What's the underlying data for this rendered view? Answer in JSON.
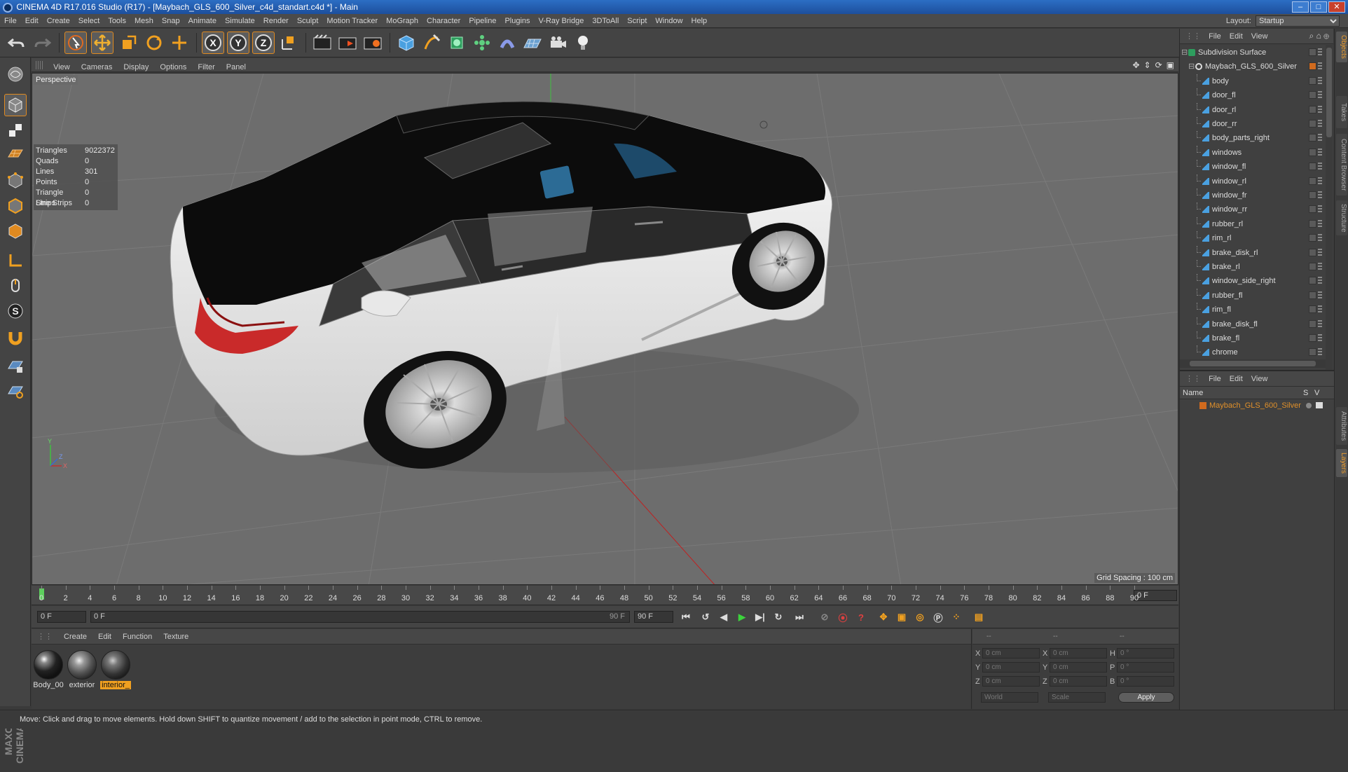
{
  "window": {
    "title": "CINEMA 4D R17.016 Studio (R17) - [Maybach_GLS_600_Silver_c4d_standart.c4d *] - Main"
  },
  "menubar": [
    "File",
    "Edit",
    "Create",
    "Select",
    "Tools",
    "Mesh",
    "Snap",
    "Animate",
    "Simulate",
    "Render",
    "Sculpt",
    "Motion Tracker",
    "MoGraph",
    "Character",
    "Pipeline",
    "Plugins",
    "V-Ray Bridge",
    "3DToAll",
    "Script",
    "Window",
    "Help"
  ],
  "layout": {
    "label": "Layout:",
    "value": "Startup"
  },
  "viewport": {
    "menu": [
      "View",
      "Cameras",
      "Display",
      "Options",
      "Filter",
      "Panel"
    ],
    "camera_label": "Perspective",
    "grid_spacing": "Grid Spacing : 100 cm",
    "stats": [
      {
        "k": "Triangles",
        "v": "9022372"
      },
      {
        "k": "Quads",
        "v": "0"
      },
      {
        "k": "Lines",
        "v": "301"
      },
      {
        "k": "Points",
        "v": "0"
      },
      {
        "k": "Triangle Strips",
        "v": "0"
      },
      {
        "k": "Line Strips",
        "v": "0"
      }
    ],
    "axis": {
      "x": "X",
      "y": "Y",
      "z": "Z"
    }
  },
  "timeline": {
    "ticks": [
      "0",
      "2",
      "4",
      "6",
      "8",
      "10",
      "12",
      "14",
      "16",
      "18",
      "20",
      "22",
      "24",
      "26",
      "28",
      "30",
      "32",
      "34",
      "36",
      "38",
      "40",
      "42",
      "44",
      "46",
      "48",
      "50",
      "52",
      "54",
      "56",
      "58",
      "60",
      "62",
      "64",
      "66",
      "68",
      "70",
      "72",
      "74",
      "76",
      "78",
      "80",
      "82",
      "84",
      "86",
      "88",
      "90"
    ],
    "end_field": "0 F",
    "current_frame": 0
  },
  "transport": {
    "start_field": "0 F",
    "range_start": "0 F",
    "range_end": "90 F",
    "end_field": "90 F"
  },
  "materials": {
    "menu": [
      "Create",
      "Edit",
      "Function",
      "Texture"
    ],
    "items": [
      {
        "name": "Body_00"
      },
      {
        "name": "exterior"
      },
      {
        "name": "interior_"
      }
    ]
  },
  "coords": {
    "header": [
      "--",
      "--",
      "--"
    ],
    "rows": [
      {
        "a": "X",
        "av": "0 cm",
        "b": "X",
        "bv": "0 cm",
        "c": "H",
        "cv": "0 °"
      },
      {
        "a": "Y",
        "av": "0 cm",
        "b": "Y",
        "bv": "0 cm",
        "c": "P",
        "cv": "0 °"
      },
      {
        "a": "Z",
        "av": "0 cm",
        "b": "Z",
        "bv": "0 cm",
        "c": "B",
        "cv": "0 °"
      }
    ],
    "mode1": "World",
    "mode2": "Scale",
    "apply": "Apply"
  },
  "status": "Move: Click and drag to move elements. Hold down SHIFT to quantize movement / add to the selection in point mode, CTRL to remove.",
  "objects": {
    "menu": [
      "File",
      "Edit",
      "View"
    ],
    "items": [
      {
        "name": "Subdivision Surface",
        "indent": 0,
        "kind": "subd"
      },
      {
        "name": "Maybach_GLS_600_Silver",
        "indent": 1,
        "kind": "null"
      },
      {
        "name": "body",
        "indent": 2,
        "kind": "poly"
      },
      {
        "name": "door_fl",
        "indent": 2,
        "kind": "poly"
      },
      {
        "name": "door_rl",
        "indent": 2,
        "kind": "poly"
      },
      {
        "name": "door_rr",
        "indent": 2,
        "kind": "poly"
      },
      {
        "name": "body_parts_right",
        "indent": 2,
        "kind": "poly"
      },
      {
        "name": "windows",
        "indent": 2,
        "kind": "poly"
      },
      {
        "name": "window_fl",
        "indent": 2,
        "kind": "poly"
      },
      {
        "name": "window_rl",
        "indent": 2,
        "kind": "poly"
      },
      {
        "name": "window_fr",
        "indent": 2,
        "kind": "poly"
      },
      {
        "name": "window_rr",
        "indent": 2,
        "kind": "poly"
      },
      {
        "name": "rubber_rl",
        "indent": 2,
        "kind": "poly"
      },
      {
        "name": "rim_rl",
        "indent": 2,
        "kind": "poly"
      },
      {
        "name": "brake_disk_rl",
        "indent": 2,
        "kind": "poly"
      },
      {
        "name": "brake_rl",
        "indent": 2,
        "kind": "poly"
      },
      {
        "name": "window_side_right",
        "indent": 2,
        "kind": "poly"
      },
      {
        "name": "rubber_fl",
        "indent": 2,
        "kind": "poly"
      },
      {
        "name": "rim_fl",
        "indent": 2,
        "kind": "poly"
      },
      {
        "name": "brake_disk_fl",
        "indent": 2,
        "kind": "poly"
      },
      {
        "name": "brake_fl",
        "indent": 2,
        "kind": "poly"
      },
      {
        "name": "chrome",
        "indent": 2,
        "kind": "poly"
      }
    ]
  },
  "layers": {
    "menu": [
      "File",
      "Edit",
      "View"
    ],
    "header": {
      "name": "Name",
      "s": "S",
      "v": "V"
    },
    "items": [
      {
        "name": "Maybach_GLS_600_Silver",
        "color": "#d06a1e"
      }
    ]
  },
  "sidetabs": [
    "Objects",
    "Takes",
    "Content Browser",
    "Structure",
    "Attributes",
    "Layers"
  ],
  "colors": {
    "accent": "#f0a030",
    "viewport_bg": "#6d6d6d",
    "selection": "#e0902a"
  }
}
